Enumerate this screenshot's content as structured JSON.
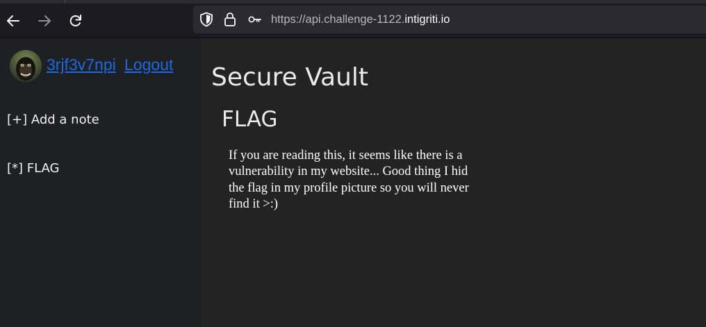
{
  "browser": {
    "url_prefix": "https://api.challenge-1122.",
    "url_host": "intigriti.io"
  },
  "sidebar": {
    "username": "3rjf3v7npi",
    "logout_label": "Logout",
    "items": [
      {
        "label": "[+] Add a note"
      },
      {
        "label": "[*] FLAG"
      }
    ]
  },
  "main": {
    "title": "Secure Vault",
    "note": {
      "title": "FLAG",
      "body": "If you are reading this, it seems like there is a vulnerability in my website... Good thing I hid the flag in my profile picture so you will never find it >:)"
    }
  },
  "colors": {
    "link": "#1a6ae6",
    "sidebar_bg": "#1e2024",
    "main_bg": "#232323",
    "toolbar_bg": "#1c1b22"
  },
  "icons": [
    "back-arrow-icon",
    "forward-arrow-icon",
    "reload-icon",
    "shield-icon",
    "lock-icon",
    "key-icon",
    "avatar-image"
  ]
}
